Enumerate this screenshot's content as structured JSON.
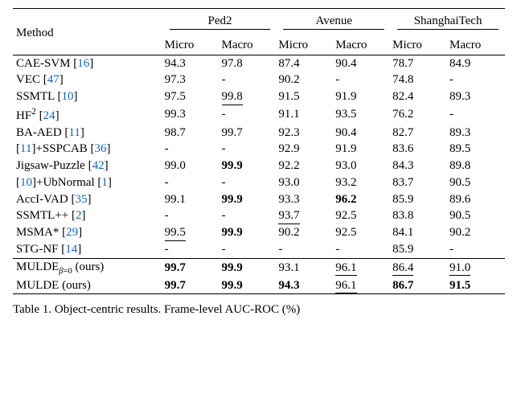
{
  "header": {
    "method": "Method",
    "groups": [
      "Ped2",
      "Avenue",
      "ShanghaiTech"
    ],
    "sub": [
      "Micro",
      "Macro"
    ]
  },
  "rows": [
    {
      "method_plain": "CAE-SVM",
      "cite": "16",
      "vals": [
        "94.3",
        "97.8",
        "87.4",
        "90.4",
        "78.7",
        "84.9"
      ],
      "fmt": [
        "",
        "",
        "",
        "",
        "",
        ""
      ]
    },
    {
      "method_plain": "VEC",
      "cite": "47",
      "vals": [
        "97.3",
        "-",
        "90.2",
        "-",
        "74.8",
        "-"
      ],
      "fmt": [
        "",
        "",
        "",
        "",
        "",
        ""
      ]
    },
    {
      "method_plain": "SSMTL",
      "cite": "10",
      "vals": [
        "97.5",
        "99.8",
        "91.5",
        "91.9",
        "82.4",
        "89.3"
      ],
      "fmt": [
        "",
        "u",
        "",
        "",
        "",
        ""
      ]
    },
    {
      "method_html": "HF<sup>2</sup>",
      "cite": "24",
      "vals": [
        "99.3",
        "-",
        "91.1",
        "93.5",
        "76.2",
        "-"
      ],
      "fmt": [
        "",
        "",
        "",
        "",
        "",
        ""
      ]
    },
    {
      "method_plain": "BA-AED",
      "cite": "11",
      "vals": [
        "98.7",
        "99.7",
        "92.3",
        "90.4",
        "82.7",
        "89.3"
      ],
      "fmt": [
        "",
        "",
        "",
        "",
        "",
        ""
      ]
    },
    {
      "method_pre_cite": "11",
      "method_post_plain": "+SSPCAB",
      "trail_cite": "36",
      "vals": [
        "-",
        "-",
        "92.9",
        "91.9",
        "83.6",
        "89.5"
      ],
      "fmt": [
        "",
        "",
        "",
        "",
        "",
        ""
      ]
    },
    {
      "method_plain": "Jigsaw-Puzzle",
      "cite": "42",
      "vals": [
        "99.0",
        "99.9",
        "92.2",
        "93.0",
        "84.3",
        "89.8"
      ],
      "fmt": [
        "",
        "b",
        "",
        "",
        "",
        ""
      ]
    },
    {
      "method_pre_cite": "10",
      "method_post_plain": "+UbNormal",
      "trail_cite": "1",
      "vals": [
        "-",
        "-",
        "93.0",
        "93.2",
        "83.7",
        "90.5"
      ],
      "fmt": [
        "",
        "",
        "",
        "",
        "",
        ""
      ]
    },
    {
      "method_plain": "AccI-VAD",
      "cite": "35",
      "vals": [
        "99.1",
        "99.9",
        "93.3",
        "96.2",
        "85.9",
        "89.6"
      ],
      "fmt": [
        "",
        "b",
        "",
        "b",
        "",
        ""
      ]
    },
    {
      "method_plain": "SSMTL++",
      "cite": "2",
      "vals": [
        "-",
        "-",
        "93.7",
        "92.5",
        "83.8",
        "90.5"
      ],
      "fmt": [
        "",
        "",
        "u",
        "",
        "",
        ""
      ]
    },
    {
      "method_plain": "MSMA*",
      "cite": "29",
      "vals": [
        "99.5",
        "99.9",
        "90.2",
        "92.5",
        "84.1",
        "90.2"
      ],
      "fmt": [
        "u",
        "b",
        "",
        "",
        "",
        ""
      ]
    },
    {
      "method_plain": "STG-NF",
      "cite": "14",
      "vals": [
        "-",
        "-",
        "-",
        "-",
        "85.9",
        "-"
      ],
      "fmt": [
        "",
        "",
        "",
        "",
        "",
        ""
      ]
    }
  ],
  "ours": [
    {
      "method_html": "MULDE<sub><i>β</i>=0</sub> (ours)",
      "vals": [
        "99.7",
        "99.9",
        "93.1",
        "96.1",
        "86.4",
        "91.0"
      ],
      "fmt": [
        "b",
        "b",
        "",
        "u",
        "u",
        "u"
      ]
    },
    {
      "method_plain": "MULDE (ours)",
      "vals": [
        "99.7",
        "99.9",
        "94.3",
        "96.1",
        "86.7",
        "91.5"
      ],
      "fmt": [
        "b",
        "b",
        "b",
        "u",
        "b",
        "b"
      ]
    }
  ],
  "caption_prefix": "Table 1. ",
  "caption_fragment": "Object-centric results. Frame-level AUC-ROC (%)"
}
